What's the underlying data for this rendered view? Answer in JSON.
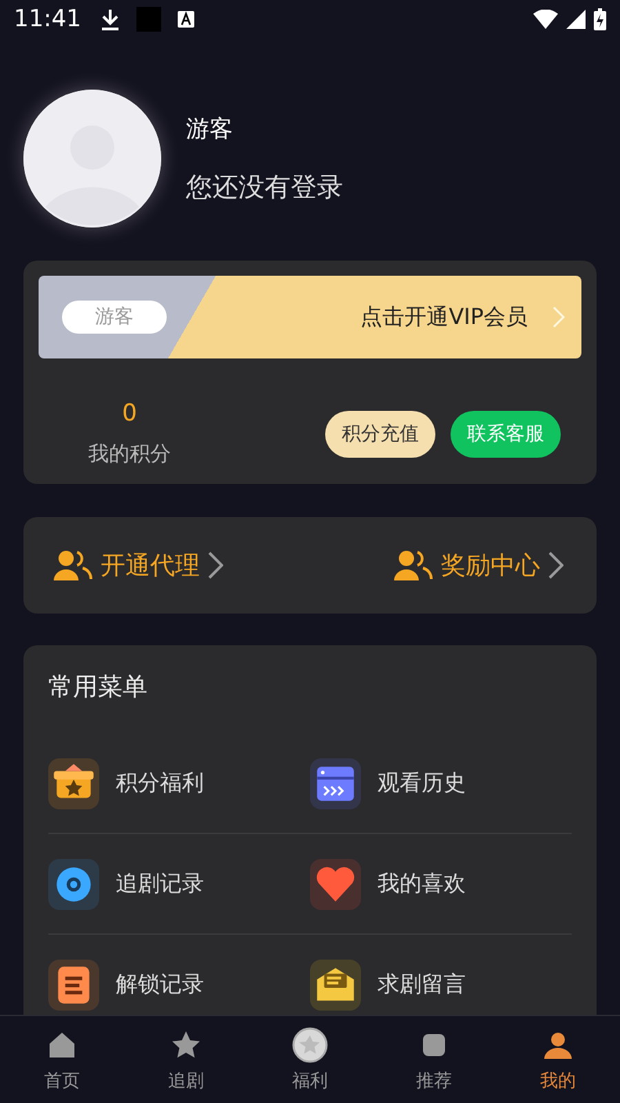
{
  "status_bar": {
    "time": "11:41"
  },
  "profile": {
    "name": "游客",
    "subtitle": "您还没有登录"
  },
  "vip_banner": {
    "badge": "游客",
    "cta": "点击开通VIP会员"
  },
  "points": {
    "value": "0",
    "label": "我的积分",
    "buttons": [
      "积分充值",
      "联系客服"
    ]
  },
  "links": [
    "开通代理",
    "奖励中心"
  ],
  "menu": {
    "title": "常用菜单",
    "items": [
      {
        "label": "积分福利"
      },
      {
        "label": "观看历史"
      },
      {
        "label": "追剧记录"
      },
      {
        "label": "我的喜欢"
      },
      {
        "label": "解锁记录"
      },
      {
        "label": "求剧留言"
      }
    ]
  },
  "tabs": [
    {
      "label": "首页",
      "selected": false
    },
    {
      "label": "追剧",
      "selected": false
    },
    {
      "label": "福利",
      "selected": false
    },
    {
      "label": "推荐",
      "selected": false
    },
    {
      "label": "我的",
      "selected": true
    }
  ]
}
